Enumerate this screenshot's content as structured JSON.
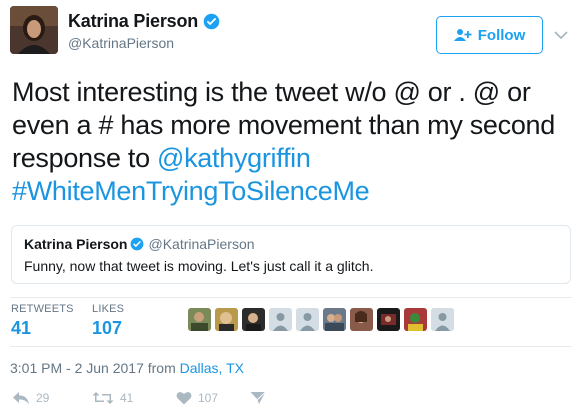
{
  "profile": {
    "display_name": "Katrina Pierson",
    "handle": "@KatrinaPierson",
    "follow_label": "Follow"
  },
  "tweet": {
    "text_part1": "Most interesting is the tweet w/o @ or . @ or even a # has more movement than my second response to ",
    "mention": "@kathygriffin",
    "hashtag": "#WhiteMenTryingToSilenceMe"
  },
  "quote": {
    "display_name": "Katrina Pierson",
    "handle": "@KatrinaPierson",
    "text": "Funny, now that tweet is moving. Let's just call it a glitch."
  },
  "stats": {
    "retweets_label": "RETWEETS",
    "retweets_value": "41",
    "likes_label": "LIKES",
    "likes_value": "107"
  },
  "timestamp": {
    "time": "3:01 PM - 2 Jun 2017 from ",
    "location": "Dallas, TX"
  },
  "actions": {
    "reply_count": "29",
    "retweet_count": "41",
    "like_count": "107"
  },
  "colors": {
    "accent": "#1da1f2",
    "link": "#1b95e0",
    "muted": "#657786",
    "action_gray": "#aab8c2"
  },
  "icons": [
    "verified-badge-icon",
    "follow-person-icon",
    "chevron-down-icon",
    "reply-icon",
    "retweet-icon",
    "heart-icon",
    "message-icon"
  ]
}
